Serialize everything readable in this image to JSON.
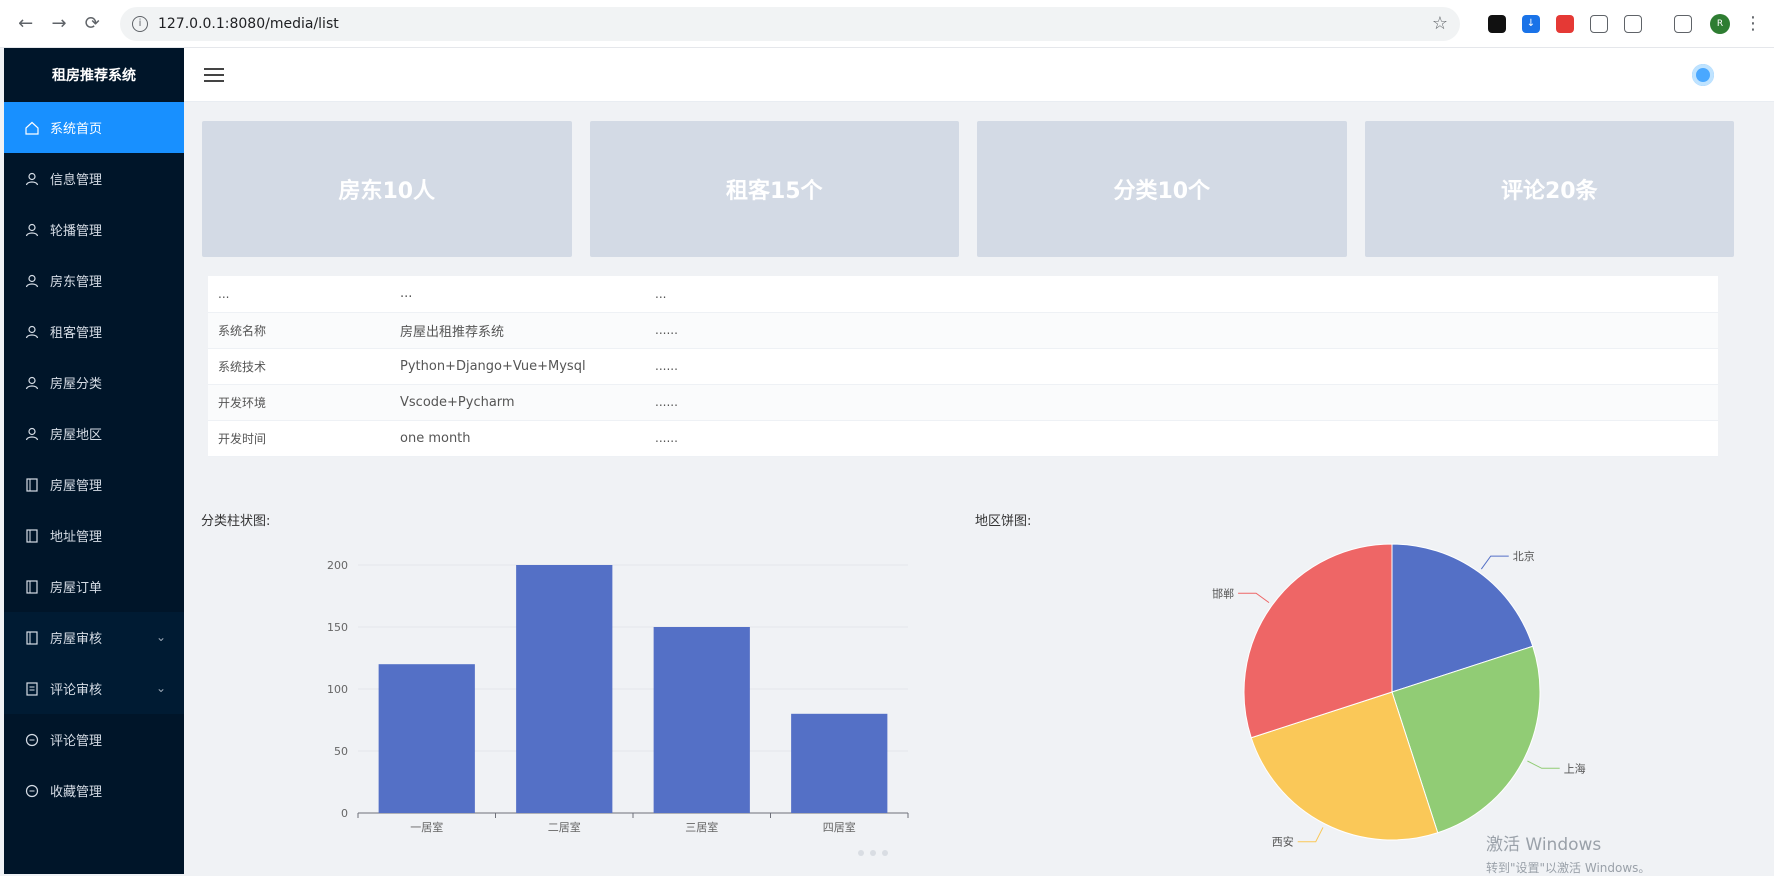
{
  "browser": {
    "url": "127.0.0.1:8080/media/list"
  },
  "sidebar": {
    "title": "租房推荐系统",
    "items": [
      {
        "label": "系统首页",
        "icon": "home-icon",
        "active": true
      },
      {
        "label": "信息管理",
        "icon": "user-icon"
      },
      {
        "label": "轮播管理",
        "icon": "user-icon"
      },
      {
        "label": "房东管理",
        "icon": "user-icon"
      },
      {
        "label": "租客管理",
        "icon": "user-icon"
      },
      {
        "label": "房屋分类",
        "icon": "user-icon"
      },
      {
        "label": "房屋地区",
        "icon": "user-icon"
      },
      {
        "label": "房屋管理",
        "icon": "tablet-icon"
      },
      {
        "label": "地址管理",
        "icon": "tablet-icon"
      },
      {
        "label": "房屋订单",
        "icon": "tablet-icon"
      },
      {
        "label": "房屋审核",
        "icon": "tablet-icon",
        "expandable": true
      },
      {
        "label": "评论审核",
        "icon": "document-icon",
        "expandable": true
      },
      {
        "label": "评论管理",
        "icon": "chat-icon"
      },
      {
        "label": "收藏管理",
        "icon": "chat-icon"
      }
    ]
  },
  "stats": [
    {
      "label": "房东10人"
    },
    {
      "label": "租客15个"
    },
    {
      "label": "分类10个"
    },
    {
      "label": "评论20条"
    }
  ],
  "info_table": [
    [
      "...",
      "...",
      "..."
    ],
    [
      "系统名称",
      "房屋出租推荐系统",
      "......"
    ],
    [
      "系统技术",
      "Python+Django+Vue+Mysql",
      "......"
    ],
    [
      "开发环境",
      "Vscode+Pycharm",
      "......"
    ],
    [
      "开发时间",
      "one month",
      "......"
    ]
  ],
  "charts": {
    "bar_label": "分类柱状图:",
    "pie_label": "地区饼图:"
  },
  "chart_data": [
    {
      "type": "bar",
      "categories": [
        "一居室",
        "二居室",
        "三居室",
        "四居室"
      ],
      "values": [
        120,
        200,
        150,
        80
      ],
      "ylim": [
        0,
        200
      ],
      "yticks": [
        0,
        50,
        100,
        150,
        200
      ],
      "color": "#5470c6"
    },
    {
      "type": "pie",
      "labels": [
        "北京",
        "上海",
        "西安",
        "邯郸"
      ],
      "values": [
        20,
        25,
        25,
        30
      ],
      "colors": [
        "#5470c6",
        "#91cc75",
        "#fac858",
        "#ee6666"
      ]
    }
  ],
  "watermark": {
    "line1": "激活 Windows",
    "line2": "转到\"设置\"以激活 Windows。"
  },
  "colors": {
    "sidebar_bg": "#001529",
    "active": "#1890ff",
    "card_bg": "#d3dae5"
  }
}
